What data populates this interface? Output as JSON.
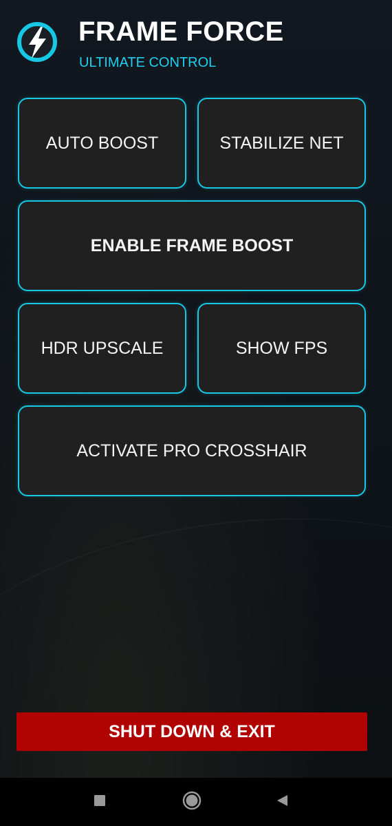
{
  "header": {
    "title": "FRAME FORCE",
    "subtitle": "ULTIMATE CONTROL",
    "logo_icon": "lightning-bolt-icon"
  },
  "buttons": {
    "auto_boost": "AUTO BOOST",
    "stabilize_net": "STABILIZE NET",
    "enable_frame_boost": "ENABLE FRAME BOOST",
    "hdr_upscale": "HDR UPSCALE",
    "show_fps": "SHOW FPS",
    "activate_pro_crosshair": "ACTIVATE PRO CROSSHAIR"
  },
  "exit": {
    "label": "SHUT DOWN & EXIT"
  },
  "navbar": {
    "recents_icon": "square-icon",
    "home_icon": "circle-icon",
    "back_icon": "triangle-back-icon"
  },
  "colors": {
    "accent": "#16c8e3",
    "subtitle": "#1fd0ee",
    "button_bg": "#202020",
    "exit_bg": "#b10202",
    "background": "#0f141a"
  }
}
